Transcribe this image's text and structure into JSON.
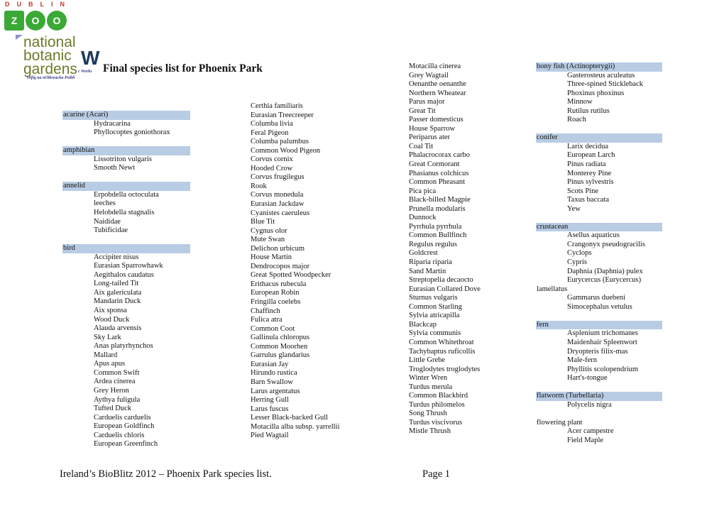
{
  "logos": {
    "dublin_zoo": {
      "top_text": "DUBLIN",
      "letters": [
        "Z",
        "O",
        "O"
      ],
      "color": "#3aa935",
      "top_color": "#c0392b"
    },
    "national_botanic_gardens": {
      "lines": [
        "national",
        "botanic",
        "gardens"
      ],
      "color": "#6e7a2a"
    },
    "opw": {
      "mark": "W",
      "works_text": "c Works",
      "irish_text": "Oifig na nOibreacha Poiblí",
      "color": "#1d3a5c"
    }
  },
  "title": "Final species list for Phoenix Park",
  "header_color": "#b8cce4",
  "columns": [
    {
      "groups": [
        {
          "category": "acarine (Acari)",
          "highlight": true,
          "items": [
            "Hydracarina",
            "Phyllocoptes goniothorax"
          ]
        },
        {
          "category": "amphibian",
          "highlight": true,
          "items": [
            "Lissotriton vulgaris",
            "Smooth Newt"
          ]
        },
        {
          "category": "annelid",
          "highlight": true,
          "items": [
            "Erpobdella octoculata",
            "leeches",
            "Helobdella stagnalis",
            "Naididae",
            "Tubificidae"
          ]
        },
        {
          "category": "bird",
          "highlight": true,
          "items": [
            "Accipiter nisus",
            "Eurasian Sparrowhawk",
            "Aegithalos caudatus",
            "Long-tailed Tit",
            "Aix galericulata",
            "Mandarin Duck",
            "Aix sponsa",
            "Wood Duck",
            "Alauda arvensis",
            "Sky Lark",
            "Anas platyrhynchos",
            "Mallard",
            "Apus apus",
            "Common Swift",
            "Ardea cinerea",
            "Grey Heron",
            "Aythya fuligula",
            "Tufted Duck",
            "Carduelis carduelis",
            "European Goldfinch",
            "Carduelis chloris",
            "European Greenfinch"
          ]
        }
      ]
    },
    {
      "items": [
        "Certhia familiaris",
        "Eurasian Treecreeper",
        "Columba livia",
        "Feral Pigeon",
        "Columba palumbus",
        "Common Wood Pigeon",
        "Corvus cornix",
        "Hooded Crow",
        "Corvus frugilegus",
        "Rook",
        "Corvus monedula",
        "Eurasian Jackdaw",
        "Cyanistes caeruleus",
        "Blue Tit",
        "Cygnus olor",
        "Mute Swan",
        "Delichon urbicum",
        "House Martin",
        "Dendrocopos major",
        "Great Spotted Woodpecker",
        "Erithacus rubecula",
        "European Robin",
        "Fringilla coelebs",
        "Chaffinch",
        "Fulica atra",
        "Common Coot",
        "Gallinula chloropus",
        "Common Moorhen",
        "Garrulus glandarius",
        "Eurasian Jay",
        "Hirundo rustica",
        "Barn Swallow",
        "Larus argentatus",
        "Herring Gull",
        "Larus fuscus",
        "Lesser Black-backed Gull",
        "Motacilla alba subsp. yarrellii",
        "Pied Wagtail"
      ]
    },
    {
      "items": [
        "Motacilla cinerea",
        "Grey Wagtail",
        "Oenanthe oenanthe",
        "Northern Wheatear",
        "Parus major",
        "Great Tit",
        "Passer domesticus",
        "House Sparrow",
        "Periparus ater",
        "Coal Tit",
        "Phalacrocorax carbo",
        "Great Cormorant",
        "Phasianus colchicus",
        "Common Pheasant",
        "Pica pica",
        "Black-billed Magpie",
        "Prunella modularis",
        "Dunnock",
        "Pyrrhula pyrrhula",
        "Common Bullfinch",
        "Regulus regulus",
        "Goldcrest",
        "Riparia riparia",
        "Sand Martin",
        "Streptopelia decaocto",
        "Eurasian Collared Dove",
        "Sturnus vulgaris",
        "Common Starling",
        "Sylvia atricapilla",
        "Blackcap",
        "Sylvia communis",
        "Common Whitethroat",
        "Tachybaptus ruficollis",
        "Little Grebe",
        "Troglodytes troglodytes",
        "Winter Wren",
        "Turdus merula",
        "Common Blackbird",
        "Turdus philomelos",
        "Song Thrush",
        "Turdus viscivorus",
        "Mistle Thrush"
      ]
    },
    {
      "groups": [
        {
          "category": "bony fish (Actinopterygii)",
          "highlight": true,
          "items": [
            "Gasterosteus aculeatus",
            "Three-spined Stickleback",
            "Phoxinus phoxinus",
            "Minnow",
            "Rutilus rutilus",
            "Roach"
          ]
        },
        {
          "category": "conifer",
          "highlight": true,
          "items": [
            "Larix decidua",
            "European Larch",
            "Pinus radiata",
            "Monterey Pine",
            "Pinus sylvestris",
            "Scots Pine",
            "Taxus baccata",
            "Yew"
          ]
        },
        {
          "category": "crustacean",
          "highlight": true,
          "items": [
            "Asellus aquaticus",
            "Crangonyx pseudogracilis",
            "Cyclops",
            "Cypris",
            "Daphnia (Daphnia) pulex",
            "Eurycercus (Eurycercus)"
          ],
          "wrapped_line": "lamellatus",
          "items_after": [
            "Gammarus duebeni",
            "Simocephalus vetulus"
          ]
        },
        {
          "category": "fern",
          "highlight": true,
          "items": [
            "Asplenium trichomanes",
            "Maidenhair Spleenwort",
            "Dryopteris filix-mas",
            "Male-fern",
            "Phyllitis scolopendrium",
            "Hart's-tongue"
          ]
        },
        {
          "category": "flatworm (Turbellaria)",
          "highlight": true,
          "items": [
            "Polycelis nigra"
          ]
        },
        {
          "category": "flowering plant",
          "highlight": false,
          "items": [
            "Acer campestre",
            "Field Maple"
          ]
        }
      ]
    }
  ],
  "footer": {
    "left": "Ireland’s BioBlitz 2012 – Phoenix Park species list.",
    "right": "Page 1"
  }
}
